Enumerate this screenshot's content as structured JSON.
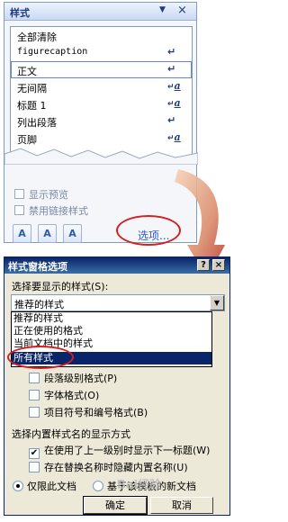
{
  "styles_pane": {
    "title": "样式",
    "dropdown_glyph": "▼",
    "close_glyph": "×",
    "items": [
      {
        "label": "全部清除",
        "marker": ""
      },
      {
        "label": "figurecaption",
        "marker": "↵"
      },
      {
        "label": "正文",
        "marker": "↵"
      },
      {
        "label": "无间隔",
        "marker": "a"
      },
      {
        "label": "标题 1",
        "marker": "a"
      },
      {
        "label": "列出段落",
        "marker": "↵"
      },
      {
        "label": "页脚",
        "marker": "a"
      }
    ],
    "show_preview_label": "显示预览",
    "disable_linked_label": "禁用链接样式",
    "toolbar": {
      "new_style_icon_text": "A",
      "inspector_icon_text": "A",
      "manage_icon_text": "A"
    },
    "options_link": "选项..."
  },
  "dialog": {
    "title": "样式窗格选项",
    "help_glyph": "?",
    "close_glyph": "×",
    "select_label": "选择要显示的样式(S):",
    "select_value": "推荐的样式",
    "dropdown_options": [
      "推荐的样式",
      "正在使用的格式",
      "当前文档中的样式",
      "所有样式"
    ],
    "format_checkboxes": [
      {
        "label": "段落级别格式(P)",
        "checked": false
      },
      {
        "label": "字体格式(O)",
        "checked": false
      },
      {
        "label": "项目符号和编号格式(B)",
        "checked": false
      }
    ],
    "builtin_section_label": "选择内置样式名的显示方式",
    "builtin_checkboxes": [
      {
        "label": "在使用了上一级别时显示下一标题(W)",
        "checked": true
      },
      {
        "label": "存在替换名称时隐藏内置名称(U)",
        "checked": false
      }
    ],
    "radios": [
      {
        "label": "仅限此文档",
        "selected": true
      },
      {
        "label": "基于该模板的新文档",
        "selected": false
      }
    ],
    "ok_label": "确定",
    "cancel_label": "取消"
  },
  "watermark": "Bai经验",
  "colors": {
    "annotation_red": "#d42020",
    "accent": "#1d3b82",
    "highlight": "#0a246a"
  }
}
